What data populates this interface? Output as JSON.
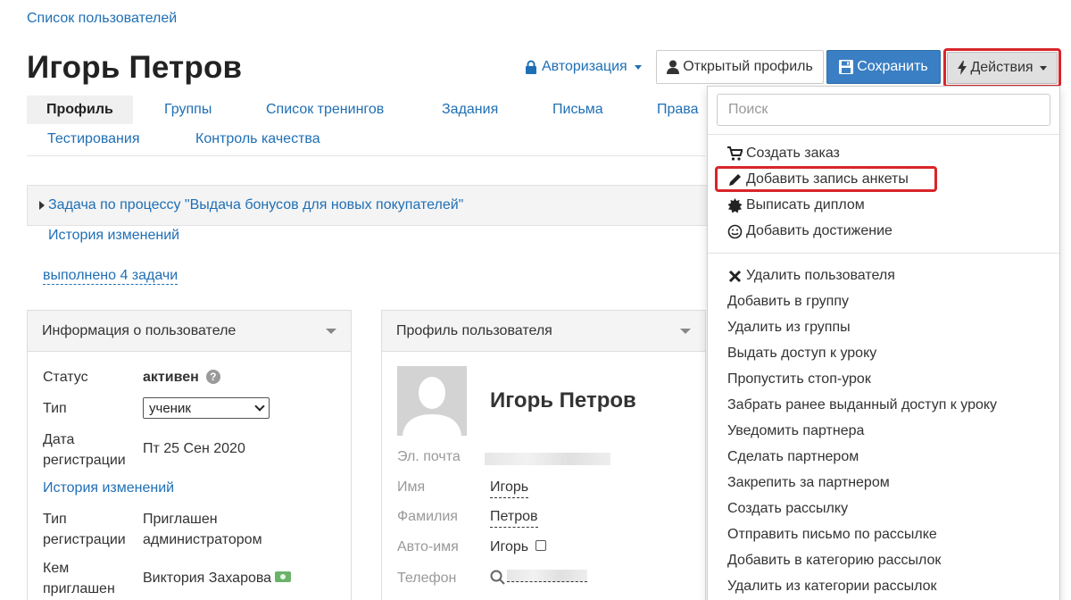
{
  "breadcrumb": "Список пользователей",
  "page_title": "Игорь Петров",
  "header": {
    "auth_label": "Авторизация",
    "open_profile_label": "Открытый профиль",
    "save_label": "Сохранить",
    "actions_label": "Действия"
  },
  "tabs": [
    "Профиль",
    "Группы",
    "Список тренингов",
    "Задания",
    "Письма",
    "Права",
    "Тестирования",
    "Контроль качества"
  ],
  "task_bar": {
    "title": "Задача по процессу \"Выдача бонусов для новых покупателей\"",
    "history_label": "История изменений",
    "tasks_done": "выполнено 4 задачи"
  },
  "user_info": {
    "title": "Информация о пользователе",
    "status_label": "Статус",
    "status_value": "активен",
    "help_icon": "?",
    "type_label": "Тип",
    "type_value": "ученик",
    "reg_date_label_1": "Дата",
    "reg_date_label_2": "регистрации",
    "reg_date_value": "Пт 25 Сен 2020",
    "history_label": "История изменений",
    "reg_type_label_1": "Тип",
    "reg_type_label_2": "регистрации",
    "reg_type_value_1": "Приглашен",
    "reg_type_value_2": "администратором",
    "invited_by_label_1": "Кем",
    "invited_by_label_2": "приглашен",
    "invited_by_value": "Виктория Захарова"
  },
  "profile": {
    "title": "Профиль пользователя",
    "name": "Игорь Петров",
    "email_label": "Эл. почта",
    "first_name_label": "Имя",
    "first_name_value": "Игорь",
    "last_name_label": "Фамилия",
    "last_name_value": "Петров",
    "autoname_label": "Авто-имя",
    "autoname_value": "Игорь",
    "phone_label": "Телефон"
  },
  "dropdown": {
    "search_placeholder": "Поиск",
    "group1": [
      "Создать заказ",
      "Добавить запись анкеты",
      "Выписать диплом",
      "Добавить достижение"
    ],
    "group2": [
      "Удалить пользователя",
      "Добавить в группу",
      "Удалить из группы",
      "Выдать доступ к уроку",
      "Пропустить стоп-урок",
      "Забрать ранее выданный доступ к уроку",
      "Уведомить партнера",
      "Сделать партнером",
      "Закрепить за партнером",
      "Создать рассылку",
      "Отправить письмо по рассылке",
      "Добавить в категорию рассылок",
      "Удалить из категории рассылок"
    ]
  },
  "colors": {
    "link": "#1f6fb5",
    "primary_button": "#3a7fc4",
    "highlight": "#d9252a"
  }
}
